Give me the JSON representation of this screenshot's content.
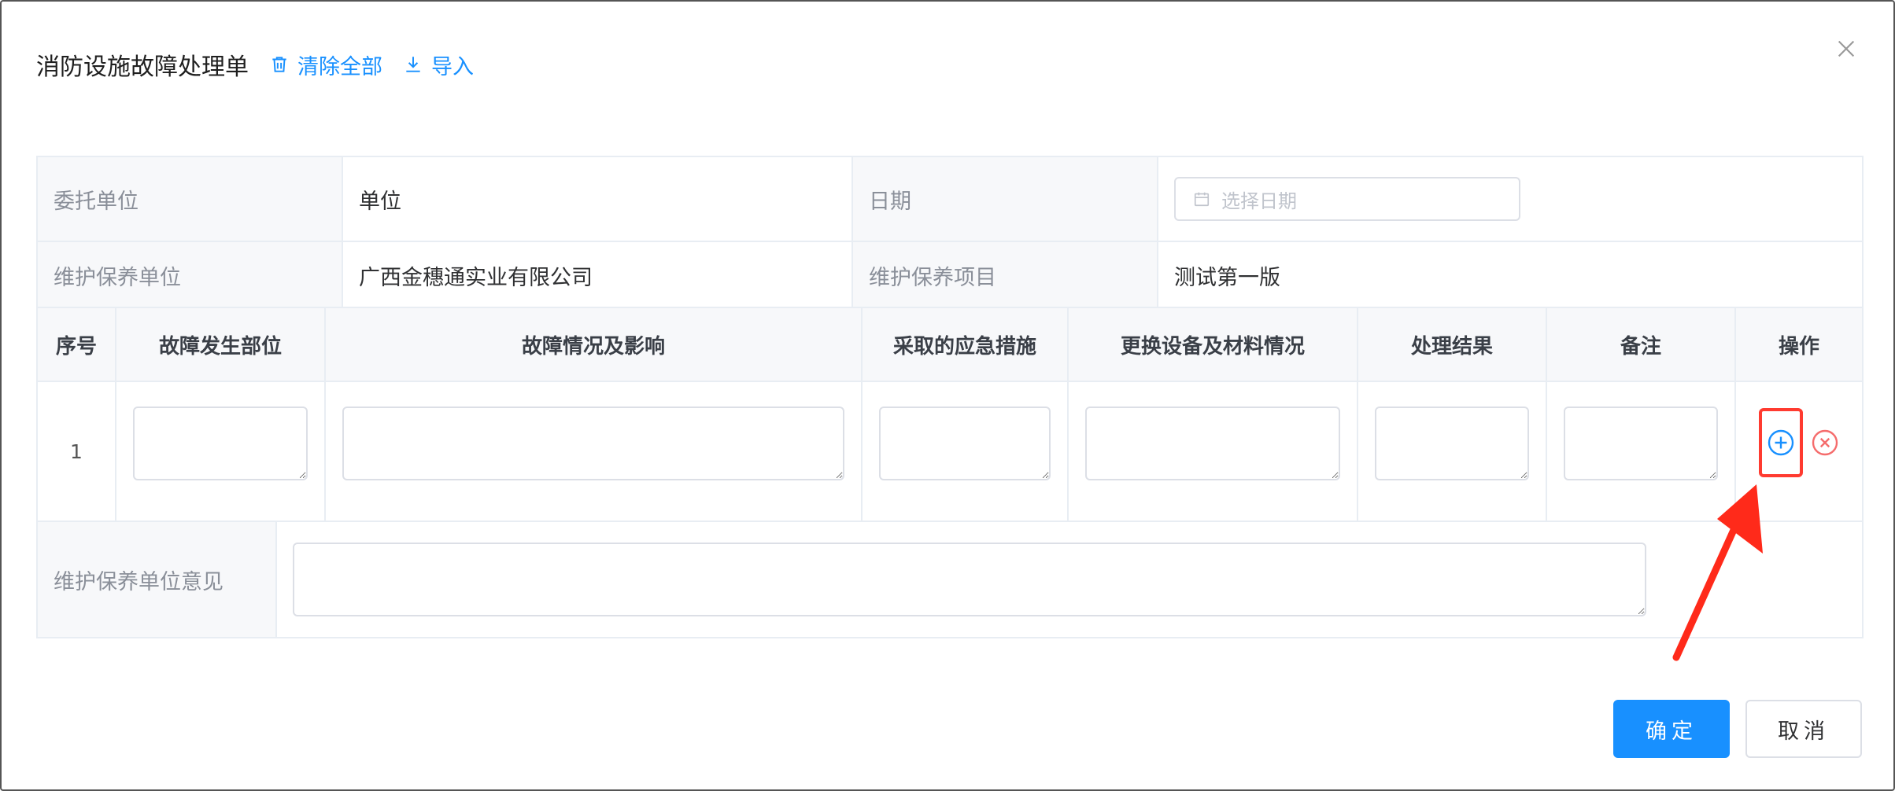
{
  "dialog": {
    "title": "消防设施故障处理单",
    "clear_all_label": "清除全部",
    "import_label": "导入"
  },
  "info": {
    "client_unit_label": "委托单位",
    "client_unit_value": "单位",
    "date_label": "日期",
    "date_placeholder": "选择日期",
    "maint_unit_label": "维护保养单位",
    "maint_unit_value": "广西金穗通实业有限公司",
    "maint_project_label": "维护保养项目",
    "maint_project_value": "测试第一版"
  },
  "fault_table": {
    "columns": [
      "序号",
      "故障发生部位",
      "故障情况及影响",
      "采取的应急措施",
      "更换设备及材料情况",
      "处理结果",
      "备注",
      "操作"
    ],
    "rows": [
      {
        "index": "1"
      }
    ]
  },
  "opinion": {
    "label": "维护保养单位意见"
  },
  "footer": {
    "ok_label": "确定",
    "cancel_label": "取消"
  },
  "colors": {
    "accent": "#1890ff",
    "danger": "#f56c6c",
    "highlight": "#ff3b30"
  },
  "icons": {
    "clear": "trash-icon",
    "import": "download-icon",
    "close": "close-icon",
    "date": "calendar-icon",
    "add_row": "plus-circle-icon",
    "delete_row": "x-circle-icon"
  }
}
